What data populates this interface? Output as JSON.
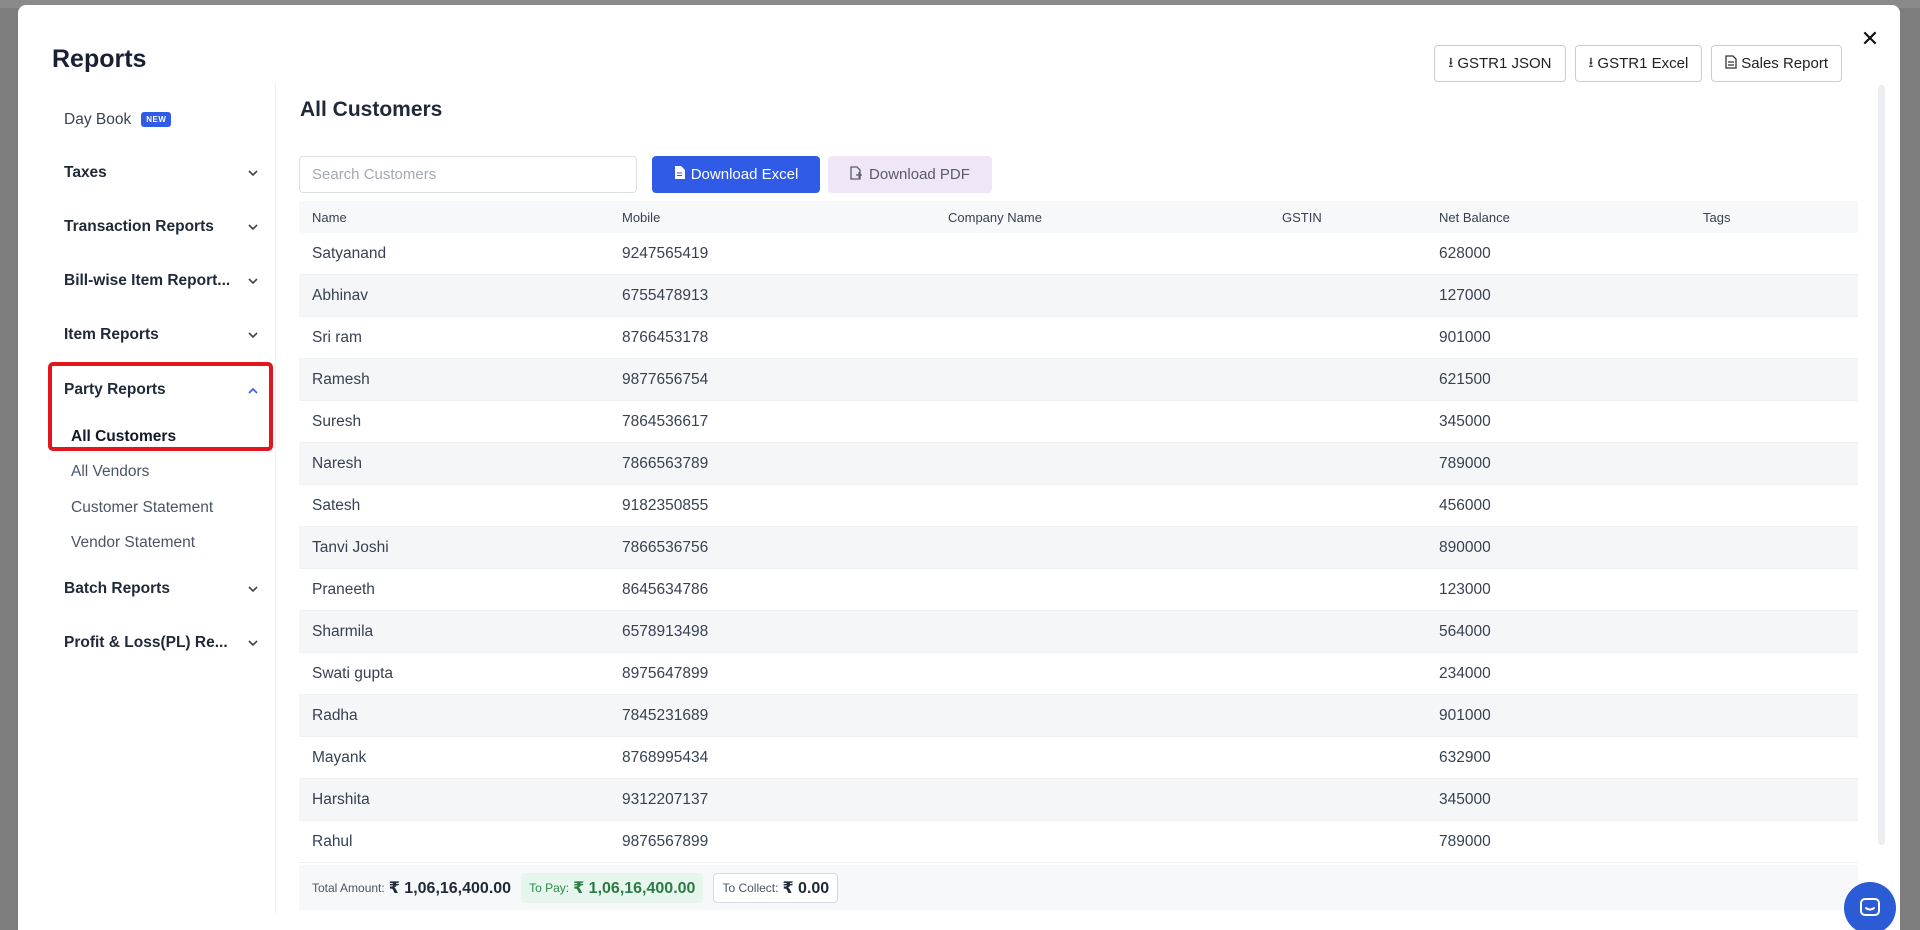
{
  "modal": {
    "title": "Reports",
    "close_glyph": "✕"
  },
  "top_actions": [
    {
      "label": "GSTR1 JSON",
      "icon": "download-icon"
    },
    {
      "label": "GSTR1 Excel",
      "icon": "download-icon"
    },
    {
      "label": "Sales Report",
      "icon": "document-icon"
    }
  ],
  "sidebar": {
    "day_book": {
      "label": "Day Book",
      "badge": "NEW"
    },
    "groups": [
      {
        "label": "Taxes",
        "chevron": "⌄"
      },
      {
        "label": "Transaction Reports",
        "chevron": "⌄"
      },
      {
        "label": "Bill-wise Item Report...",
        "chevron": "⌄"
      },
      {
        "label": "Item Reports",
        "chevron": "⌄"
      },
      {
        "label": "Party Reports",
        "chevron": "⌃"
      },
      {
        "label": "Batch Reports",
        "chevron": "⌄"
      },
      {
        "label": "Profit & Loss(PL) Re...",
        "chevron": "⌄"
      }
    ],
    "party_items": [
      "All Customers",
      "All Vendors",
      "Customer Statement",
      "Vendor Statement"
    ],
    "active_item": "All Customers",
    "highlight_color": "#e2161c"
  },
  "main": {
    "title": "All Customers",
    "search_placeholder": "Search Customers",
    "download_excel": "Download Excel",
    "download_pdf": "Download PDF",
    "accent_color": "#2f5be7"
  },
  "table": {
    "headers": [
      "Name",
      "Mobile",
      "Company Name",
      "GSTIN",
      "Net Balance",
      "Tags"
    ],
    "rows": [
      [
        "Satyanand",
        "9247565419",
        "",
        "",
        "628000",
        ""
      ],
      [
        "Abhinav",
        "6755478913",
        "",
        "",
        "127000",
        ""
      ],
      [
        "Sri ram",
        "8766453178",
        "",
        "",
        "901000",
        ""
      ],
      [
        "Ramesh",
        "9877656754",
        "",
        "",
        "621500",
        ""
      ],
      [
        "Suresh",
        "7864536617",
        "",
        "",
        "345000",
        ""
      ],
      [
        "Naresh",
        "7866563789",
        "",
        "",
        "789000",
        ""
      ],
      [
        "Satesh",
        "9182350855",
        "",
        "",
        "456000",
        ""
      ],
      [
        "Tanvi Joshi",
        "7866536756",
        "",
        "",
        "890000",
        ""
      ],
      [
        "Praneeth",
        "8645634786",
        "",
        "",
        "123000",
        ""
      ],
      [
        "Sharmila",
        "6578913498",
        "",
        "",
        "564000",
        ""
      ],
      [
        "Swati gupta",
        "8975647899",
        "",
        "",
        "234000",
        ""
      ],
      [
        "Radha",
        "7845231689",
        "",
        "",
        "901000",
        ""
      ],
      [
        "Mayank",
        "8768995434",
        "",
        "",
        "632900",
        ""
      ],
      [
        "Harshita",
        "9312207137",
        "",
        "",
        "345000",
        ""
      ],
      [
        "Rahul",
        "9876567899",
        "",
        "",
        "789000",
        ""
      ]
    ]
  },
  "footer": {
    "total_label": "Total Amount:",
    "total_value": "₹ 1,06,16,400.00",
    "topay_label": "To Pay:",
    "topay_value": "₹ 1,06,16,400.00",
    "collect_label": "To Collect:",
    "collect_value": "₹ 0.00"
  }
}
